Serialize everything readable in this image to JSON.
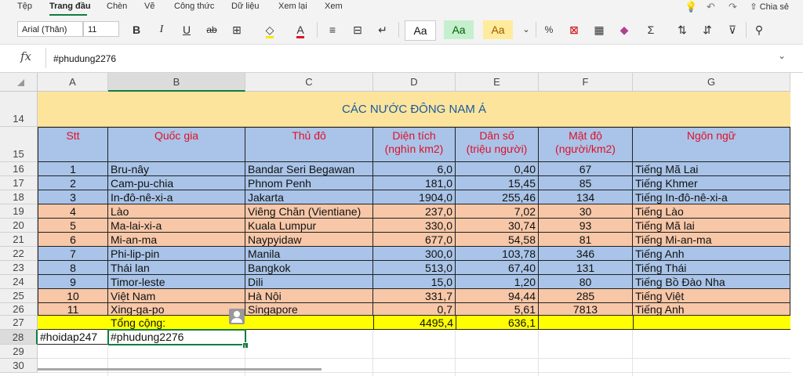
{
  "menu": [
    "Tệp",
    "Trang đầu",
    "Chèn",
    "Vẽ",
    "Công thức",
    "Dữ liệu",
    "Xem lại",
    "Xem"
  ],
  "share_label": "Chia sẻ",
  "toolbar": {
    "font": "Arial (Thân)",
    "size": "11",
    "bold": "B",
    "italic": "I",
    "underline": "U",
    "strike": "ab",
    "style_normal": "Aa",
    "style_good": "Aa",
    "style_neutral": "Aa",
    "sum": "Σ"
  },
  "formula": {
    "fx": "fx",
    "value": "#phudung2276"
  },
  "columns": [
    "A",
    "B",
    "C",
    "D",
    "E",
    "F",
    "G"
  ],
  "rows": [
    "14",
    "15",
    "16",
    "17",
    "18",
    "19",
    "20",
    "21",
    "22",
    "23",
    "24",
    "25",
    "26",
    "27",
    "28",
    "29",
    "30"
  ],
  "sheet": {
    "title": "CÁC NƯỚC ĐÔNG NAM Á",
    "headers": [
      "Stt",
      "Quốc gia",
      "Thủ đô",
      "Diện tích\n(nghìn km2)",
      "Dân số\n(triệu người)",
      "Mật độ\n(người/km2)",
      "Ngôn ngữ"
    ],
    "data": [
      [
        "1",
        "Bru-nây",
        "Bandar Seri Begawan",
        "6,0",
        "0,40",
        "67",
        "Tiếng Mã Lai"
      ],
      [
        "2",
        "Cam-pu-chia",
        "Phnom Penh",
        "181,0",
        "15,45",
        "85",
        "Tiếng Khmer"
      ],
      [
        "3",
        "In-đô-nê-xi-a",
        "Jakarta",
        "1904,0",
        "255,46",
        "134",
        "Tiếng In-đô-nê-xi-a"
      ],
      [
        "4",
        "Lào",
        "Viêng Chăn (Vientiane)",
        "237,0",
        "7,02",
        "30",
        "Tiếng Lào"
      ],
      [
        "5",
        "Ma-lai-xi-a",
        "Kuala Lumpur",
        "330,0",
        "30,74",
        "93",
        "Tiếng Mã lai"
      ],
      [
        "6",
        "Mi-an-ma",
        "Naypyidaw",
        "677,0",
        "54,58",
        "81",
        "Tiếng Mi-an-ma"
      ],
      [
        "7",
        "Phi-lip-pin",
        "Manila",
        "300,0",
        "103,78",
        "346",
        "Tiếng Anh"
      ],
      [
        "8",
        "Thái lan",
        "Bangkok",
        "513,0",
        "67,40",
        "131",
        "Tiếng Thái"
      ],
      [
        "9",
        "Timor-leste",
        "Dili",
        "15,0",
        "1,20",
        "80",
        "Tiếng Bồ Đào Nha"
      ],
      [
        "10",
        "Việt Nam",
        "Hà Nội",
        "331,7",
        "94,44",
        "285",
        "Tiếng Việt"
      ],
      [
        "11",
        "Xing-ga-po",
        "Singapore",
        "0,7",
        "5,61",
        "7813",
        "Tiếng Anh"
      ]
    ],
    "total": {
      "label": "Tổng cộng:",
      "area": "4495,4",
      "population": "636,1"
    },
    "row28": {
      "a": "#hoidap247",
      "b": "#phudung2276"
    }
  },
  "colors": {
    "title_bg": "#fde49c",
    "header_bg": "#a9c4e8",
    "blue_row": "#a9c4e8",
    "peach_row": "#f7c7a8",
    "total_bg": "#ffff00",
    "accent": "#107c41",
    "red_text": "#e0102a"
  }
}
